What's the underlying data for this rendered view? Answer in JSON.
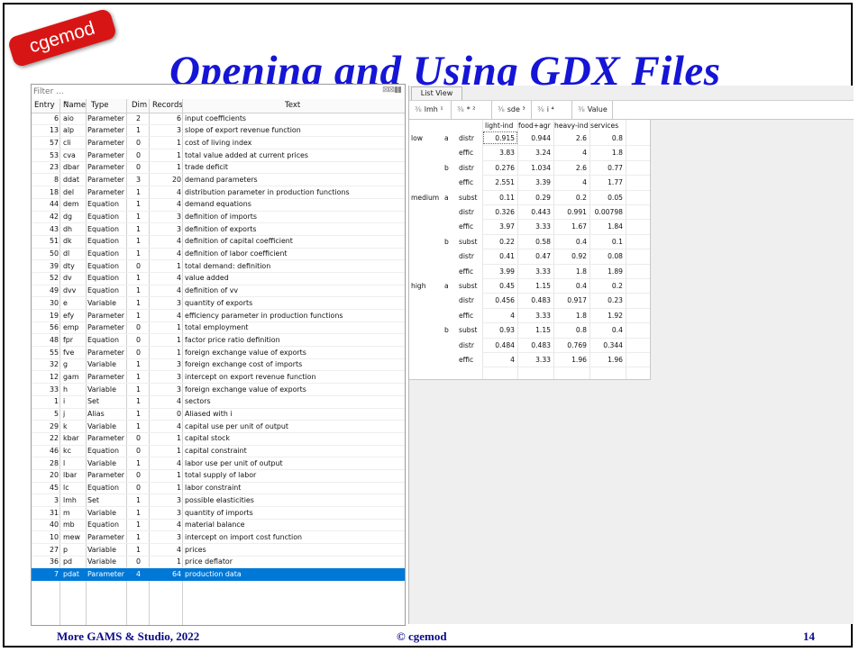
{
  "badge": "cgemod",
  "title": "Opening and Using GDX Files",
  "left": {
    "filter_placeholder": "Filter ...",
    "columns": [
      "Entry",
      "Name",
      "Type",
      "Dim",
      "Records",
      "Text"
    ],
    "rows": [
      {
        "entry": "6",
        "name": "aio",
        "type": "Parameter",
        "dim": "2",
        "records": "6",
        "text": "input coefficients"
      },
      {
        "entry": "13",
        "name": "alp",
        "type": "Parameter",
        "dim": "1",
        "records": "3",
        "text": "slope of export revenue function"
      },
      {
        "entry": "57",
        "name": "cli",
        "type": "Parameter",
        "dim": "0",
        "records": "1",
        "text": "cost of living index"
      },
      {
        "entry": "53",
        "name": "cva",
        "type": "Parameter",
        "dim": "0",
        "records": "1",
        "text": "total value added at current prices"
      },
      {
        "entry": "23",
        "name": "dbar",
        "type": "Parameter",
        "dim": "0",
        "records": "1",
        "text": "trade deficit"
      },
      {
        "entry": "8",
        "name": "ddat",
        "type": "Parameter",
        "dim": "3",
        "records": "20",
        "text": "demand parameters"
      },
      {
        "entry": "18",
        "name": "del",
        "type": "Parameter",
        "dim": "1",
        "records": "4",
        "text": "distribution parameter in production functions"
      },
      {
        "entry": "44",
        "name": "dem",
        "type": "Equation",
        "dim": "1",
        "records": "4",
        "text": "demand equations"
      },
      {
        "entry": "42",
        "name": "dg",
        "type": "Equation",
        "dim": "1",
        "records": "3",
        "text": "definition of imports"
      },
      {
        "entry": "43",
        "name": "dh",
        "type": "Equation",
        "dim": "1",
        "records": "3",
        "text": "definition of exports"
      },
      {
        "entry": "51",
        "name": "dk",
        "type": "Equation",
        "dim": "1",
        "records": "4",
        "text": "definition of capital coefficient"
      },
      {
        "entry": "50",
        "name": "dl",
        "type": "Equation",
        "dim": "1",
        "records": "4",
        "text": "definition of labor coefficient"
      },
      {
        "entry": "39",
        "name": "dty",
        "type": "Equation",
        "dim": "0",
        "records": "1",
        "text": "total demand: definition"
      },
      {
        "entry": "52",
        "name": "dv",
        "type": "Equation",
        "dim": "1",
        "records": "4",
        "text": "value added"
      },
      {
        "entry": "49",
        "name": "dvv",
        "type": "Equation",
        "dim": "1",
        "records": "4",
        "text": "definition of vv"
      },
      {
        "entry": "30",
        "name": "e",
        "type": "Variable",
        "dim": "1",
        "records": "3",
        "text": "quantity of exports"
      },
      {
        "entry": "19",
        "name": "efy",
        "type": "Parameter",
        "dim": "1",
        "records": "4",
        "text": "efficiency parameter in production functions"
      },
      {
        "entry": "56",
        "name": "emp",
        "type": "Parameter",
        "dim": "0",
        "records": "1",
        "text": "total employment"
      },
      {
        "entry": "48",
        "name": "fpr",
        "type": "Equation",
        "dim": "0",
        "records": "1",
        "text": "factor price ratio definition"
      },
      {
        "entry": "55",
        "name": "fve",
        "type": "Parameter",
        "dim": "0",
        "records": "1",
        "text": "foreign exchange value of exports"
      },
      {
        "entry": "32",
        "name": "g",
        "type": "Variable",
        "dim": "1",
        "records": "3",
        "text": "foreign exchange cost of imports"
      },
      {
        "entry": "12",
        "name": "gam",
        "type": "Parameter",
        "dim": "1",
        "records": "3",
        "text": "intercept on export revenue function"
      },
      {
        "entry": "33",
        "name": "h",
        "type": "Variable",
        "dim": "1",
        "records": "3",
        "text": "foreign exchange value of exports"
      },
      {
        "entry": "1",
        "name": "i",
        "type": "Set",
        "dim": "1",
        "records": "4",
        "text": "sectors"
      },
      {
        "entry": "5",
        "name": "j",
        "type": "Alias",
        "dim": "1",
        "records": "0",
        "text": "Aliased with i"
      },
      {
        "entry": "29",
        "name": "k",
        "type": "Variable",
        "dim": "1",
        "records": "4",
        "text": "capital use per unit of output"
      },
      {
        "entry": "22",
        "name": "kbar",
        "type": "Parameter",
        "dim": "0",
        "records": "1",
        "text": "capital stock"
      },
      {
        "entry": "46",
        "name": "kc",
        "type": "Equation",
        "dim": "0",
        "records": "1",
        "text": "capital constraint"
      },
      {
        "entry": "28",
        "name": "l",
        "type": "Variable",
        "dim": "1",
        "records": "4",
        "text": "labor use per unit of output"
      },
      {
        "entry": "20",
        "name": "lbar",
        "type": "Parameter",
        "dim": "0",
        "records": "1",
        "text": "total supply of labor"
      },
      {
        "entry": "45",
        "name": "lc",
        "type": "Equation",
        "dim": "0",
        "records": "1",
        "text": "labor constraint"
      },
      {
        "entry": "3",
        "name": "lmh",
        "type": "Set",
        "dim": "1",
        "records": "3",
        "text": "possible elasticities"
      },
      {
        "entry": "31",
        "name": "m",
        "type": "Variable",
        "dim": "1",
        "records": "3",
        "text": "quantity of imports"
      },
      {
        "entry": "40",
        "name": "mb",
        "type": "Equation",
        "dim": "1",
        "records": "4",
        "text": "material balance"
      },
      {
        "entry": "10",
        "name": "mew",
        "type": "Parameter",
        "dim": "1",
        "records": "3",
        "text": "intercept on import cost function"
      },
      {
        "entry": "27",
        "name": "p",
        "type": "Variable",
        "dim": "1",
        "records": "4",
        "text": "prices"
      },
      {
        "entry": "36",
        "name": "pd",
        "type": "Variable",
        "dim": "0",
        "records": "1",
        "text": "price deflator"
      },
      {
        "entry": "7",
        "name": "pdat",
        "type": "Parameter",
        "dim": "4",
        "records": "64",
        "text": "production data",
        "selected": true
      }
    ]
  },
  "right": {
    "list_view_label": "List View",
    "dim_headers": [
      {
        "icon": "⅜",
        "label": "lmh ¹"
      },
      {
        "icon": "⅜",
        "label": "* ²"
      },
      {
        "icon": "⅜",
        "label": "sde ³"
      },
      {
        "icon": "⅜",
        "label": "i ⁴"
      },
      {
        "icon": "⅜",
        "label": "Value"
      }
    ],
    "col_headers": [
      "light-ind",
      "food+agr",
      "heavy-ind",
      "services"
    ],
    "rows": [
      {
        "lmh": "low",
        "star": "a",
        "sde": "distr",
        "vals": [
          "0.915",
          "0.944",
          "2.6",
          "0.8"
        ]
      },
      {
        "lmh": "",
        "star": "",
        "sde": "effic",
        "vals": [
          "3.83",
          "3.24",
          "4",
          "1.8"
        ]
      },
      {
        "lmh": "",
        "star": "b",
        "sde": "distr",
        "vals": [
          "0.276",
          "1.034",
          "2.6",
          "0.77"
        ]
      },
      {
        "lmh": "",
        "star": "",
        "sde": "effic",
        "vals": [
          "2.551",
          "3.39",
          "4",
          "1.77"
        ]
      },
      {
        "lmh": "medium",
        "star": "a",
        "sde": "subst",
        "vals": [
          "0.11",
          "0.29",
          "0.2",
          "0.05"
        ]
      },
      {
        "lmh": "",
        "star": "",
        "sde": "distr",
        "vals": [
          "0.326",
          "0.443",
          "0.991",
          "0.00798"
        ]
      },
      {
        "lmh": "",
        "star": "",
        "sde": "effic",
        "vals": [
          "3.97",
          "3.33",
          "1.67",
          "1.84"
        ]
      },
      {
        "lmh": "",
        "star": "b",
        "sde": "subst",
        "vals": [
          "0.22",
          "0.58",
          "0.4",
          "0.1"
        ]
      },
      {
        "lmh": "",
        "star": "",
        "sde": "distr",
        "vals": [
          "0.41",
          "0.47",
          "0.92",
          "0.08"
        ]
      },
      {
        "lmh": "",
        "star": "",
        "sde": "effic",
        "vals": [
          "3.99",
          "3.33",
          "1.8",
          "1.89"
        ]
      },
      {
        "lmh": "high",
        "star": "a",
        "sde": "subst",
        "vals": [
          "0.45",
          "1.15",
          "0.4",
          "0.2"
        ]
      },
      {
        "lmh": "",
        "star": "",
        "sde": "distr",
        "vals": [
          "0.456",
          "0.483",
          "0.917",
          "0.23"
        ]
      },
      {
        "lmh": "",
        "star": "",
        "sde": "effic",
        "vals": [
          "4",
          "3.33",
          "1.8",
          "1.92"
        ]
      },
      {
        "lmh": "",
        "star": "b",
        "sde": "subst",
        "vals": [
          "0.93",
          "1.15",
          "0.8",
          "0.4"
        ]
      },
      {
        "lmh": "",
        "star": "",
        "sde": "distr",
        "vals": [
          "0.484",
          "0.483",
          "0.769",
          "0.344"
        ]
      },
      {
        "lmh": "",
        "star": "",
        "sde": "effic",
        "vals": [
          "4",
          "3.33",
          "1.96",
          "1.96"
        ]
      }
    ]
  },
  "footer": {
    "left": "More GAMS & Studio, 2022",
    "center": "© cgemod",
    "page": "14"
  },
  "icons": {
    "speaker": "speaker-icon"
  }
}
